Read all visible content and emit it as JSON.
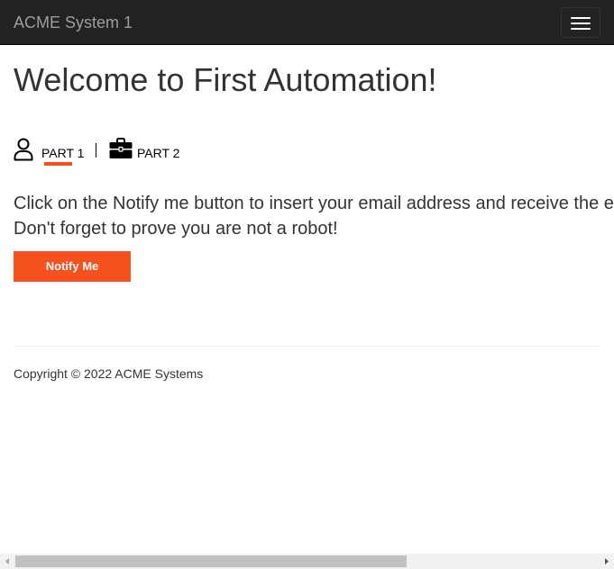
{
  "navbar": {
    "brand": "ACME System 1",
    "menu_icon": "hamburger-menu-icon"
  },
  "main": {
    "title": "Welcome to First Automation!",
    "tabs": [
      {
        "label": "PART 1",
        "icon": "user-icon",
        "active": true
      },
      {
        "label": "PART 2",
        "icon": "briefcase-icon",
        "active": false
      }
    ],
    "instructions": [
      "Click on the Notify me button to insert your email address and receive the e",
      "Don't forget to prove you are not a robot!"
    ],
    "notify_button": "Notify Me"
  },
  "footer": {
    "copyright": "Copyright © 2022 ACME Systems"
  },
  "colors": {
    "navbar_bg": "#222222",
    "accent": "#f4511e",
    "brand_text": "#9d9d9d"
  }
}
